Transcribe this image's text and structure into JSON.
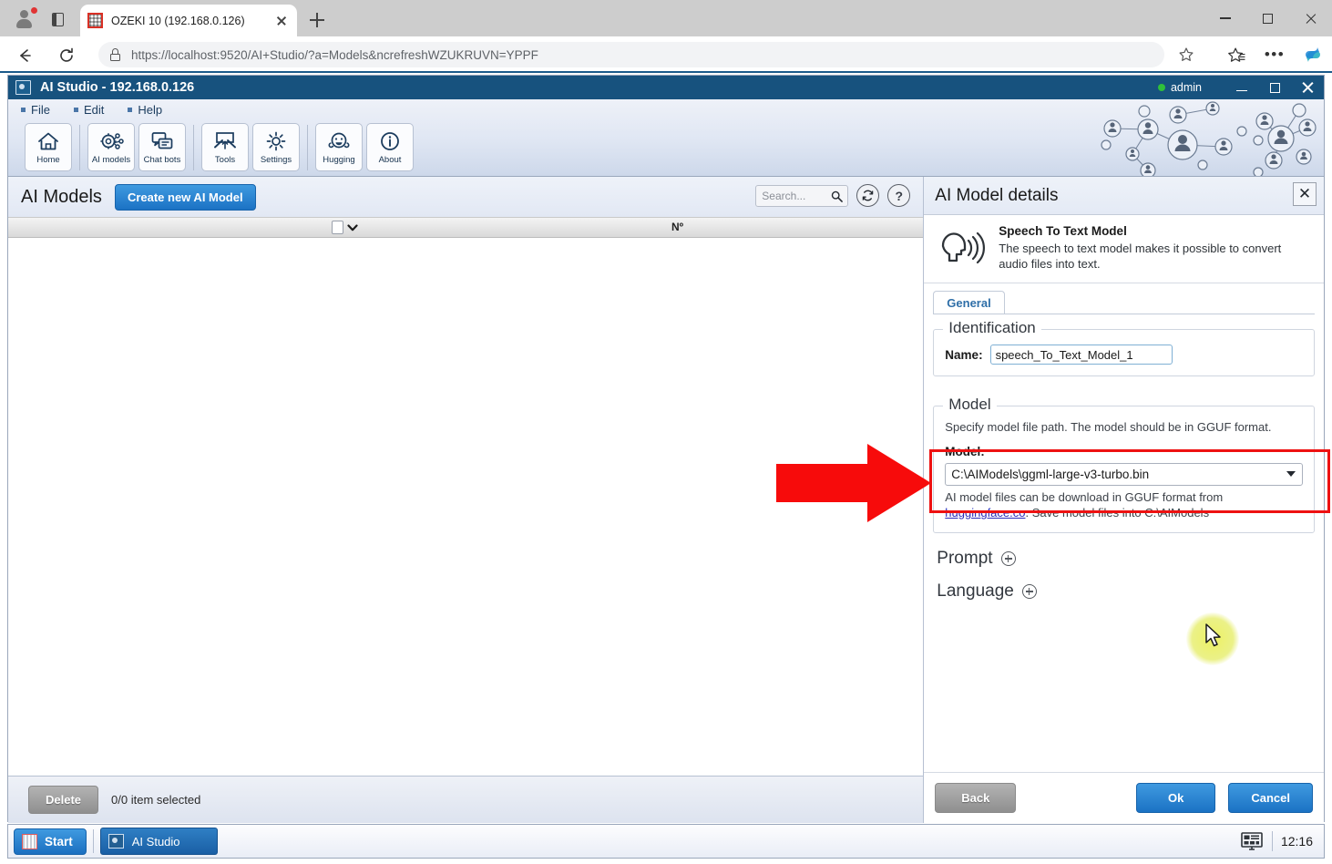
{
  "browser": {
    "tab": {
      "title": "OZEKI 10 (192.168.0.126)",
      "favicon": "ozeki-favicon"
    },
    "new_tab_label": "+",
    "url_prefix": "https://",
    "url_host": "localhost:9520",
    "url_path": "/AI+Studio/?a=Models&ncrefreshWZUKRUVN=YPPF",
    "url_full": "https://localhost:9520/AI+Studio/?a=Models&ncrefreshWZUKRUVN=YPPF",
    "icons": {
      "back": "back-arrow-icon",
      "reload": "reload-icon",
      "lock": "lock-icon",
      "star": "favorite-star-icon",
      "collections": "collections-icon",
      "more": "•••",
      "copilot": "copilot-icon"
    },
    "window_controls": {
      "minimize": "—",
      "maximize": "□",
      "close": "✕"
    }
  },
  "app": {
    "titlebar": {
      "title": "AI Studio - 192.168.0.126",
      "user": "admin",
      "status_color": "#2fbf3a",
      "minimize": "—",
      "maximize": "□",
      "close": "✕"
    },
    "menu": [
      {
        "label": "File"
      },
      {
        "label": "Edit"
      },
      {
        "label": "Help"
      }
    ],
    "toolbar": [
      {
        "label": "Home",
        "icon": "home-icon"
      },
      {
        "label": "AI models",
        "icon": "ai-models-icon"
      },
      {
        "label": "Chat bots",
        "icon": "chat-bots-icon"
      },
      {
        "label": "Tools",
        "icon": "tools-icon"
      },
      {
        "label": "Settings",
        "icon": "settings-gear-icon"
      },
      {
        "label": "Hugging",
        "icon": "hugging-face-icon"
      },
      {
        "label": "About",
        "icon": "about-info-icon"
      }
    ]
  },
  "left_pane": {
    "title": "AI Models",
    "create_button": "Create new AI Model",
    "search_placeholder": "Search...",
    "refresh_icon": "refresh-icon",
    "help_icon": "help-question-icon",
    "columns": {
      "select_all": "",
      "number": "Nº"
    },
    "rows": [],
    "footer": {
      "delete_button": "Delete",
      "selection_status": "0/0 item selected"
    }
  },
  "details": {
    "title": "AI Model details",
    "close_label": "✕",
    "model_type": {
      "icon": "speech-to-text-icon",
      "name": "Speech To Text Model",
      "description": "The speech to text model makes it possible to convert audio files into text."
    },
    "tabs": [
      {
        "label": "General",
        "active": true
      }
    ],
    "identification": {
      "legend": "Identification",
      "name_label": "Name:",
      "name_value": "speech_To_Text_Model_1"
    },
    "model": {
      "legend": "Model",
      "hint": "Specify model file path. The model should be in GGUF format.",
      "label": "Model:",
      "value": "C:\\AIModels\\ggml-large-v3-turbo.bin",
      "dropdown_icon": "chevron-down-icon",
      "footnote_part1": "AI model files can be download in GGUF format from",
      "footnote_link": "huggingface.co",
      "footnote_part2": ". Save model files into C:\\AIModels",
      "highlight_color": "#ee1111"
    },
    "collapsed_sections": [
      {
        "label": "Prompt",
        "expand_icon": "plus-circle-icon"
      },
      {
        "label": "Language",
        "expand_icon": "plus-circle-icon"
      }
    ],
    "buttons": {
      "back": "Back",
      "ok": "Ok",
      "cancel": "Cancel"
    }
  },
  "annotation": {
    "arrow_color": "#ee1111",
    "arrow_points_to": "model-select-field",
    "cursor_highlight_color": "#e4ec5a"
  },
  "taskbar": {
    "start_label": "Start",
    "tasks": [
      {
        "label": "AI Studio",
        "icon": "ai-studio-icon",
        "active": true
      }
    ],
    "tray_icon": "show-desktop-icon",
    "clock": "12:16"
  }
}
